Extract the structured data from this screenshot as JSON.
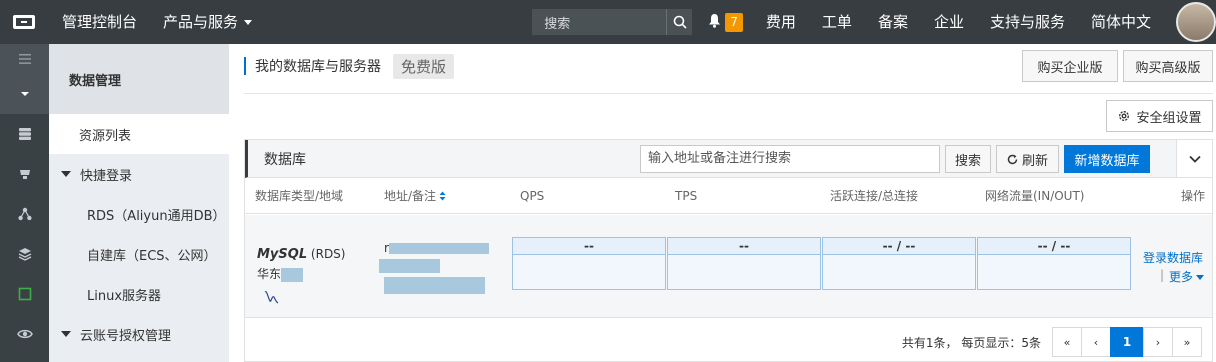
{
  "topbar": {
    "console": "管理控制台",
    "products": "产品与服务",
    "search_placeholder": "搜索",
    "notification_count": "7",
    "items": [
      "费用",
      "工单",
      "备案",
      "企业",
      "支持与服务",
      "简体中文"
    ]
  },
  "sidebar": {
    "header": "数据管理",
    "resource_list": "资源列表",
    "quick_login": "快捷登录",
    "rds": "RDS（Aliyun通用DB）",
    "self_built": "自建库（ECS、公网）",
    "linux": "Linux服务器",
    "cloud_auth": "云账号授权管理"
  },
  "main": {
    "title": "我的数据库与服务器",
    "free_tag": "免费版",
    "buy_enterprise": "购买企业版",
    "buy_advanced": "购买高级版",
    "security_group": "安全组设置"
  },
  "panel": {
    "title": "数据库",
    "search_placeholder": "输入地址或备注进行搜索",
    "search_button": "搜索",
    "refresh_button": "刷新",
    "add_button": "新增数据库",
    "columns": [
      "数据库类型/地域",
      "地址/备注",
      "QPS",
      "TPS",
      "活跃连接/总连接",
      "网络流量(IN/OUT)",
      "操作"
    ],
    "row": {
      "db_type": "MySQL",
      "db_suffix": " (RDS)",
      "region": "华东",
      "address_prefix": "r",
      "qps": "--",
      "tps": "--",
      "connections": "-- / --",
      "traffic": "-- / --",
      "login": "登录数据库",
      "more": "更多"
    }
  },
  "pagination": {
    "info": "共有1条，  每页显示：5条",
    "first": "«",
    "prev": "‹",
    "current": "1",
    "next": "›",
    "last": "»"
  },
  "colors": {
    "topbar": "#373d41",
    "primary": "#0077d9",
    "badge": "#f39800"
  }
}
